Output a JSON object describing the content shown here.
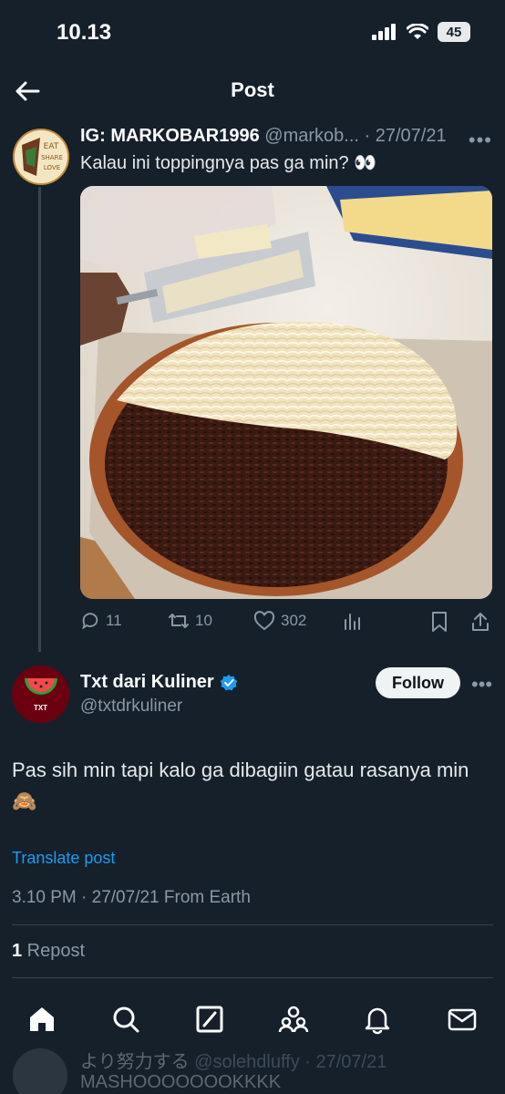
{
  "status_bar": {
    "time": "10.13",
    "battery": "45"
  },
  "header": {
    "title": "Post"
  },
  "quoted_tweet": {
    "name": "IG: MARKOBAR1996",
    "handle": "@markob...",
    "date": "· 27/07/21",
    "text": "Kalau ini toppingnya pas ga min? 👀",
    "avatar_text": "EAT SHARE LOVE",
    "replies": "11",
    "reposts": "10",
    "likes": "302"
  },
  "main_tweet": {
    "name": "Txt dari Kuliner",
    "handle": "@txtdrkuliner",
    "avatar_text": "TXT",
    "follow_label": "Follow",
    "text": "Pas sih min tapi kalo ga dibagiin gatau rasanya min 🙈",
    "translate_label": "Translate post",
    "meta": "3.10 PM · 27/07/21 From Earth",
    "repost_count": "1",
    "repost_label": " Repost"
  },
  "next_tweet": {
    "name": "より努力する",
    "handle": "@solehdluffy · 27/07/21",
    "text": "MASHOOOOOOOKKKK"
  },
  "colors": {
    "background": "#15202b",
    "accent": "#1d9bf0",
    "muted": "#8b98a5",
    "divider": "#38444d"
  },
  "icons": [
    "back-arrow-icon",
    "signal-icon",
    "wifi-icon",
    "reply-icon",
    "repost-icon",
    "like-icon",
    "stats-icon",
    "bookmark-icon",
    "share-icon",
    "verified-icon",
    "home-icon",
    "search-icon",
    "grok-icon",
    "communities-icon",
    "notifications-icon",
    "messages-icon"
  ]
}
